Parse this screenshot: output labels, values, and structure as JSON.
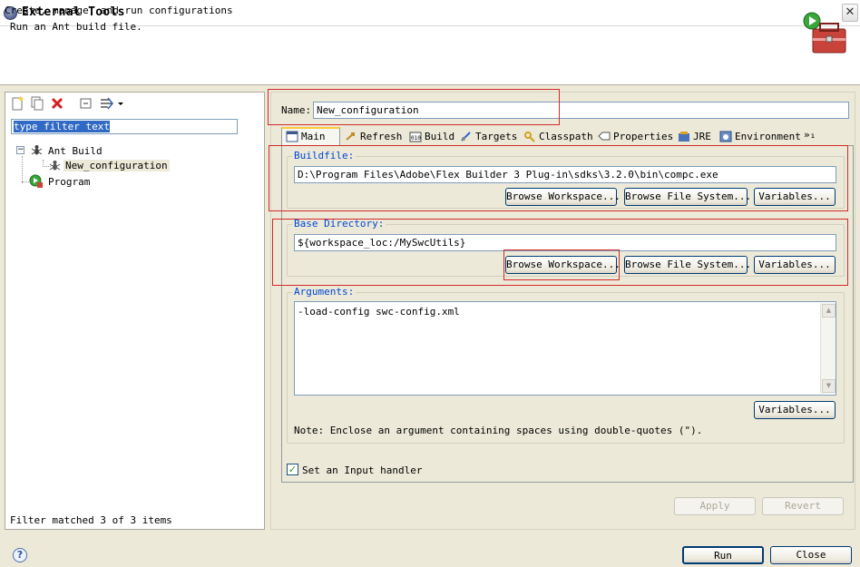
{
  "window": {
    "title": "External Tools",
    "close_glyph": "✕"
  },
  "banner": {
    "line1": "Create, manage, and run configurations",
    "line2": "Run an Ant build file.",
    "icon": "toolbox-run-icon"
  },
  "left": {
    "toolbar": [
      "new-config-icon",
      "duplicate-icon",
      "delete-icon",
      "collapse-all-icon",
      "filter-icon"
    ],
    "filter_value": "type filter text",
    "tree": [
      {
        "label": "Ant Build",
        "icon": "ant-icon",
        "expanded": true
      },
      {
        "label": "New_configuration",
        "icon": "ant-config-icon",
        "selected": true
      },
      {
        "label": "Program",
        "icon": "program-icon"
      }
    ],
    "toggle_glyph": "−",
    "status": "Filter matched 3 of 3 items"
  },
  "name": {
    "label": "Name:",
    "value": "New_configuration"
  },
  "tabs": [
    {
      "label": "Main",
      "icon": "main-tab-icon",
      "active": true
    },
    {
      "label": "Refresh",
      "icon": "refresh-icon"
    },
    {
      "label": "Build",
      "icon": "build-icon"
    },
    {
      "label": "Targets",
      "icon": "targets-icon"
    },
    {
      "label": "Classpath",
      "icon": "classpath-icon"
    },
    {
      "label": "Properties",
      "icon": "properties-icon"
    },
    {
      "label": "JRE",
      "icon": "jre-icon"
    },
    {
      "label": "Environment",
      "icon": "environment-icon"
    }
  ],
  "tabs_overflow": "»₁",
  "buildfile": {
    "label": "Buildfile:",
    "value": "D:\\Program Files\\Adobe\\Flex Builder 3 Plug-in\\sdks\\3.2.0\\bin\\compc.exe",
    "browse_workspace": "Browse Workspace...",
    "browse_fs": "Browse File System...",
    "variables": "Variables..."
  },
  "basedir": {
    "label": "Base Directory:",
    "value": "${workspace_loc:/MySwcUtils}",
    "browse_workspace": "Browse Workspace...",
    "browse_fs": "Browse File System...",
    "variables": "Variables..."
  },
  "arguments": {
    "label": "Arguments:",
    "value": "-load-config swc-config.xml",
    "variables": "Variables...",
    "note": "Note: Enclose an argument containing spaces using double-quotes (\")."
  },
  "input_handler": {
    "label": "Set an Input handler",
    "checked": true
  },
  "buttons": {
    "apply": "Apply",
    "revert": "Revert",
    "run": "Run",
    "close": "Close"
  },
  "help_glyph": "?",
  "colors": {
    "dialog_bg": "#ece9d8",
    "group_label": "#0046d5",
    "highlight_box": "#d22a2a",
    "selection": "#316ac5"
  }
}
